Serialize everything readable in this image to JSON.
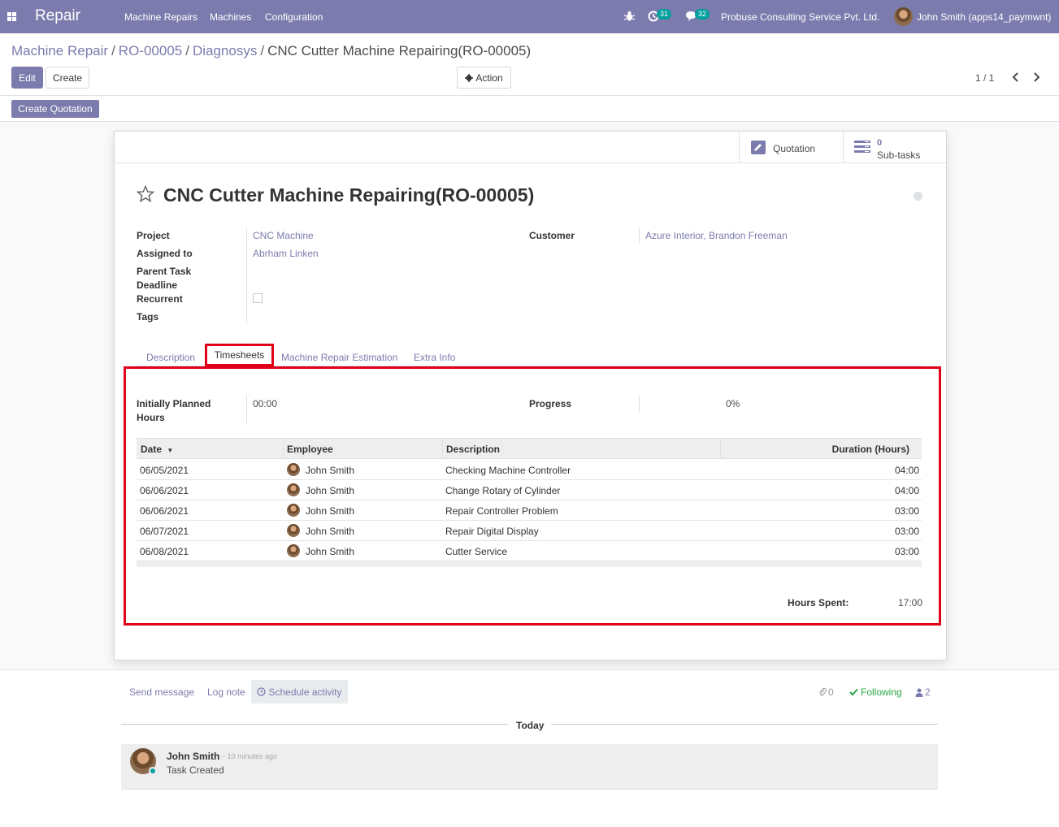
{
  "navbar": {
    "app_name": "Repair",
    "menu": [
      "Machine Repairs",
      "Machines",
      "Configuration"
    ],
    "activity_count": "31",
    "message_count": "32",
    "company": "Probuse Consulting Service Pvt. Ltd.",
    "user": "John Smith (apps14_paymwnt)"
  },
  "breadcrumb": {
    "items": [
      "Machine Repair",
      "RO-00005",
      "Diagnosys"
    ],
    "current": "CNC Cutter Machine Repairing(RO-00005)"
  },
  "control_panel": {
    "edit_label": "Edit",
    "create_label": "Create",
    "action_label": "Action",
    "pager": "1 / 1"
  },
  "statusbar": {
    "create_quotation_label": "Create Quotation"
  },
  "smart_buttons": {
    "quotation_label": "Quotation",
    "subtasks_count": "0",
    "subtasks_label": "Sub-tasks"
  },
  "form": {
    "title": "CNC Cutter Machine Repairing(RO-00005)",
    "fields": {
      "project_label": "Project",
      "project_value": "CNC Machine",
      "assigned_label": "Assigned to",
      "assigned_value": "Abrham Linken",
      "parent_label": "Parent Task",
      "deadline_label": "Deadline",
      "recurrent_label": "Recurrent",
      "tags_label": "Tags",
      "customer_label": "Customer",
      "customer_value": "Azure Interior, Brandon Freeman"
    },
    "tabs": [
      "Description",
      "Timesheets",
      "Machine Repair Estimation",
      "Extra Info"
    ],
    "timesheet": {
      "planned_label_1": "Initially Planned",
      "planned_label_2": "Hours",
      "planned_value": "00:00",
      "progress_label": "Progress",
      "progress_value": "0%",
      "columns": [
        "Date",
        "Employee",
        "Description",
        "Duration (Hours)"
      ],
      "rows": [
        {
          "date": "06/05/2021",
          "employee": "John Smith",
          "description": "Checking Machine Controller",
          "duration": "04:00"
        },
        {
          "date": "06/06/2021",
          "employee": "John Smith",
          "description": "Change Rotary of Cylinder",
          "duration": "04:00"
        },
        {
          "date": "06/06/2021",
          "employee": "John Smith",
          "description": "Repair Controller Problem",
          "duration": "03:00"
        },
        {
          "date": "06/07/2021",
          "employee": "John Smith",
          "description": "Repair Digital Display",
          "duration": "03:00"
        },
        {
          "date": "06/08/2021",
          "employee": "John Smith",
          "description": "Cutter Service",
          "duration": "03:00"
        }
      ],
      "hours_spent_label": "Hours Spent:",
      "hours_spent_value": "17:00"
    }
  },
  "chatter": {
    "send_message": "Send message",
    "log_note": "Log note",
    "schedule_activity": "Schedule activity",
    "attachments": "0",
    "following": "Following",
    "followers": "2",
    "today": "Today",
    "message_author": "John Smith",
    "message_time": "- 10 minutes ago",
    "message_body": "Task Created"
  },
  "colors": {
    "brand": "#7c7bad",
    "highlight": "#e0001a",
    "badge": "#00a09d",
    "following": "#28a745"
  }
}
